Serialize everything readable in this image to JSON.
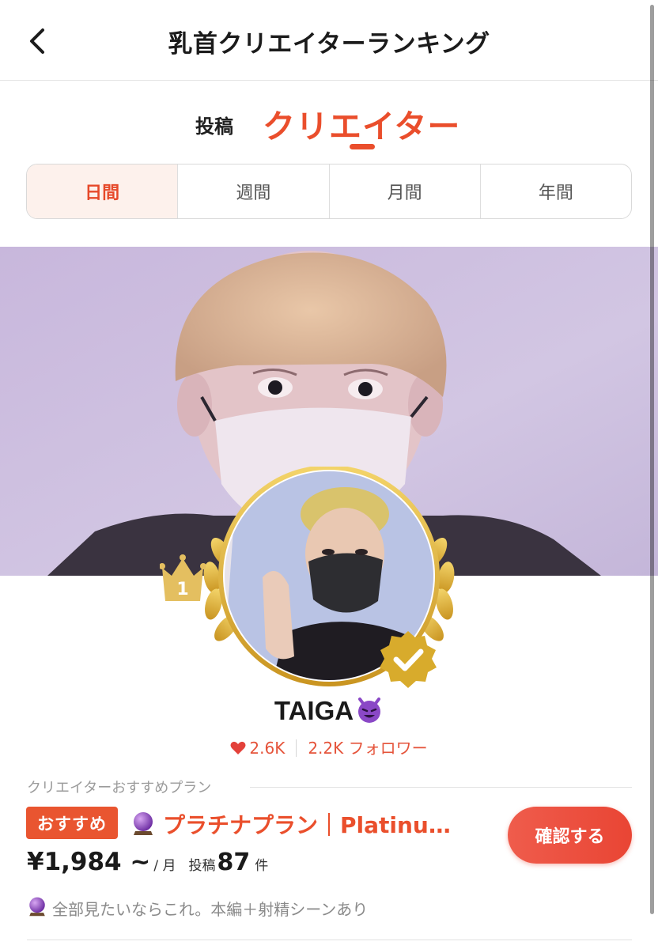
{
  "header": {
    "title": "乳首クリエイターランキング",
    "back_icon": "chevron-left-icon"
  },
  "mode_tabs": {
    "posts_label": "投稿",
    "creators_label": "クリエイター",
    "active": "creators"
  },
  "period_tabs": [
    {
      "label": "日間",
      "active": true
    },
    {
      "label": "週間",
      "active": false
    },
    {
      "label": "月間",
      "active": false
    },
    {
      "label": "年間",
      "active": false
    }
  ],
  "creator": {
    "rank": "1",
    "name": "TAIGA",
    "name_emoji": "smiling-devil-icon",
    "likes": "2.6K",
    "followers": "2.2K フォロワー",
    "verified": true
  },
  "plan_section": {
    "label": "クリエイターおすすめプラン",
    "badge": "おすすめ",
    "plan_icon": "crystal-ball-icon",
    "plan_title": "プラチナプラン｜Platinu…",
    "price": "¥1,984 ~",
    "price_unit": "/ 月",
    "posts_label": "投稿",
    "posts_count": "87",
    "posts_unit": "件",
    "description": "全部見たいならこれ。本編＋射精シーンあり",
    "confirm_button": "確認する"
  },
  "colors": {
    "accent": "#ea4e2c",
    "active_tab_bg": "#fdf1ec",
    "gold": "#d7a928",
    "muted_text": "#9b9b9b"
  }
}
